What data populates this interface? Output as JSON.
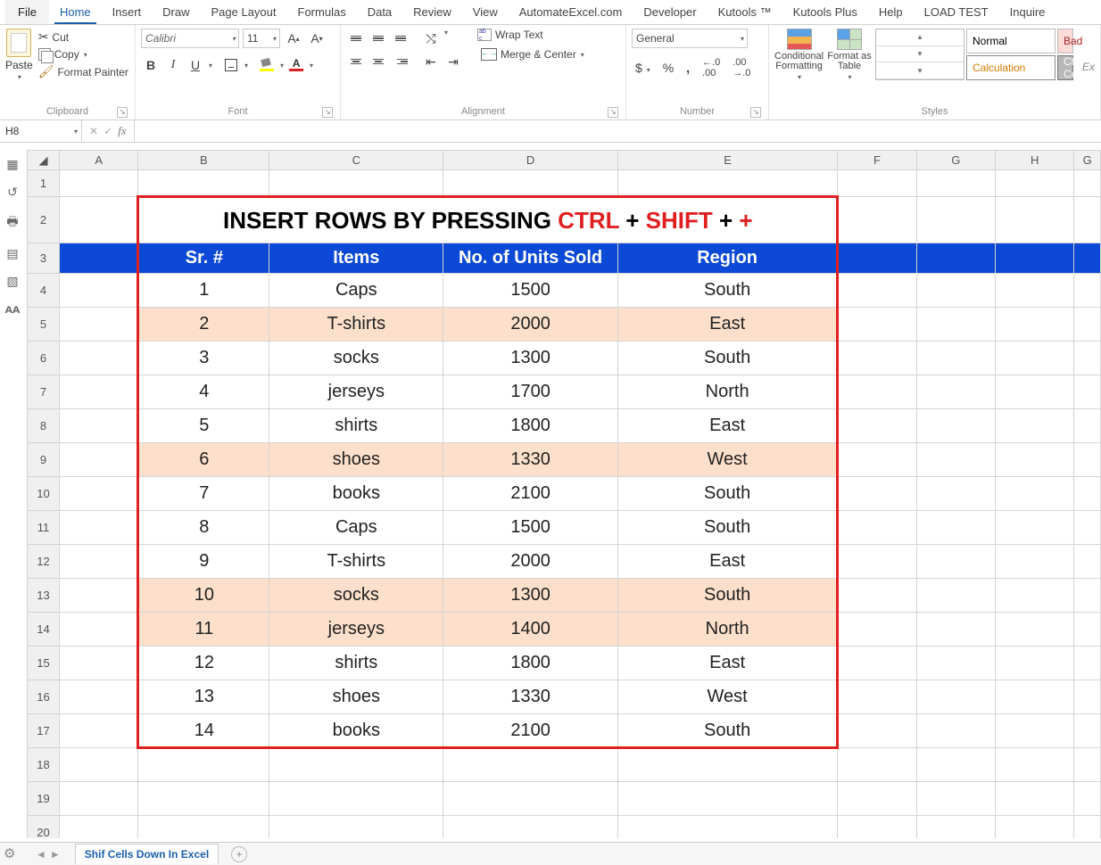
{
  "tabs": {
    "file": "File",
    "list": [
      "Home",
      "Insert",
      "Draw",
      "Page Layout",
      "Formulas",
      "Data",
      "Review",
      "View",
      "AutomateExcel.com",
      "Developer",
      "Kutools ™",
      "Kutools Plus",
      "Help",
      "LOAD TEST",
      "Inquire"
    ],
    "active_index": 0
  },
  "clipboard": {
    "paste": "Paste",
    "cut": "Cut",
    "copy": "Copy",
    "format_painter": "Format Painter",
    "label": "Clipboard"
  },
  "font": {
    "name": "Calibri",
    "size": "11",
    "label": "Font"
  },
  "alignment": {
    "wrap": "Wrap Text",
    "merge": "Merge & Center",
    "label": "Alignment"
  },
  "number": {
    "format": "General",
    "label": "Number"
  },
  "styles": {
    "cond_fmt": "Conditional Formatting",
    "fmt_table": "Format as Table",
    "g_normal": "Normal",
    "g_bad": "Bad",
    "g_calc": "Calculation",
    "g_check": "Check Cell",
    "label": "Styles",
    "explanatory": "Ex"
  },
  "namebox": "H8",
  "title": {
    "p1": "INSERT ROWS BY PRESSING ",
    "p2": "CTRL",
    "p3": " + ",
    "p4": "SHIFT",
    "p5": " + ",
    "p6": "+"
  },
  "headers": {
    "sr": "Sr. #",
    "items": "Items",
    "units": "No. of Units Sold",
    "region": "Region"
  },
  "rows": [
    {
      "n": "1",
      "item": "Caps",
      "units": "1500",
      "region": "South",
      "hl": false
    },
    {
      "n": "2",
      "item": "T-shirts",
      "units": "2000",
      "region": "East",
      "hl": true
    },
    {
      "n": "3",
      "item": "socks",
      "units": "1300",
      "region": "South",
      "hl": false
    },
    {
      "n": "4",
      "item": "jerseys",
      "units": "1700",
      "region": "North",
      "hl": false
    },
    {
      "n": "5",
      "item": "shirts",
      "units": "1800",
      "region": "East",
      "hl": false
    },
    {
      "n": "6",
      "item": "shoes",
      "units": "1330",
      "region": "West",
      "hl": true
    },
    {
      "n": "7",
      "item": "books",
      "units": "2100",
      "region": "South",
      "hl": false
    },
    {
      "n": "8",
      "item": "Caps",
      "units": "1500",
      "region": "South",
      "hl": false
    },
    {
      "n": "9",
      "item": "T-shirts",
      "units": "2000",
      "region": "East",
      "hl": false
    },
    {
      "n": "10",
      "item": "socks",
      "units": "1300",
      "region": "South",
      "hl": true
    },
    {
      "n": "11",
      "item": "jerseys",
      "units": "1400",
      "region": "North",
      "hl": true
    },
    {
      "n": "12",
      "item": "shirts",
      "units": "1800",
      "region": "East",
      "hl": false
    },
    {
      "n": "13",
      "item": "shoes",
      "units": "1330",
      "region": "West",
      "hl": false
    },
    {
      "n": "14",
      "item": "books",
      "units": "2100",
      "region": "South",
      "hl": false
    }
  ],
  "col_letters": [
    "A",
    "B",
    "C",
    "D",
    "E",
    "F",
    "G",
    "H"
  ],
  "row_numbers": [
    "1",
    "2",
    "3",
    "4",
    "5",
    "6",
    "7",
    "8",
    "9",
    "10",
    "11",
    "12",
    "13",
    "14",
    "15",
    "16",
    "17",
    "18",
    "19",
    "20"
  ],
  "sheet_tab": "Shif Cells Down In Excel",
  "last_col_letter": "G"
}
